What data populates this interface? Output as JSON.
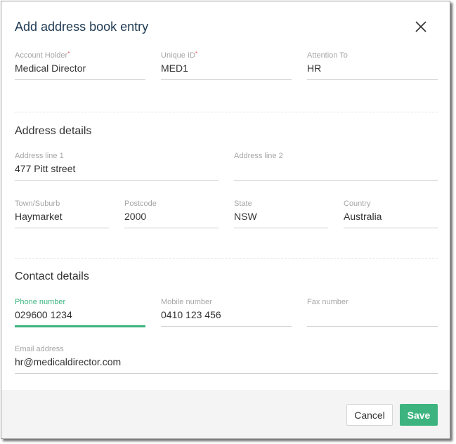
{
  "dialog": {
    "title": "Add address book entry",
    "close_icon": "close-icon"
  },
  "account": {
    "account_holder": {
      "label": "Account Holder",
      "required": "*",
      "value": "Medical Director"
    },
    "unique_id": {
      "label": "Unique ID",
      "required": "*",
      "value": "MED1"
    },
    "attention_to": {
      "label": "Attention To",
      "value": "HR"
    }
  },
  "address": {
    "section_title": "Address details",
    "line1": {
      "label": "Address line 1",
      "value": "477 Pitt street"
    },
    "line2": {
      "label": "Address line 2",
      "value": ""
    },
    "town": {
      "label": "Town/Suburb",
      "value": "Haymarket"
    },
    "postcode": {
      "label": "Postcode",
      "value": "2000"
    },
    "state": {
      "label": "State",
      "value": "NSW"
    },
    "country": {
      "label": "Country",
      "value": "Australia"
    }
  },
  "contact": {
    "section_title": "Contact details",
    "phone": {
      "label": "Phone number",
      "value": "029600 1234"
    },
    "mobile": {
      "label": "Mobile number",
      "value": "0410 123 456"
    },
    "fax": {
      "label": "Fax number",
      "value": ""
    },
    "email": {
      "label": "Email address",
      "value": "hr@medicaldirector.com"
    }
  },
  "footer": {
    "cancel_label": "Cancel",
    "save_label": "Save"
  },
  "colors": {
    "accent": "#3db47f",
    "title": "#1e3a52",
    "required": "#e05050"
  }
}
